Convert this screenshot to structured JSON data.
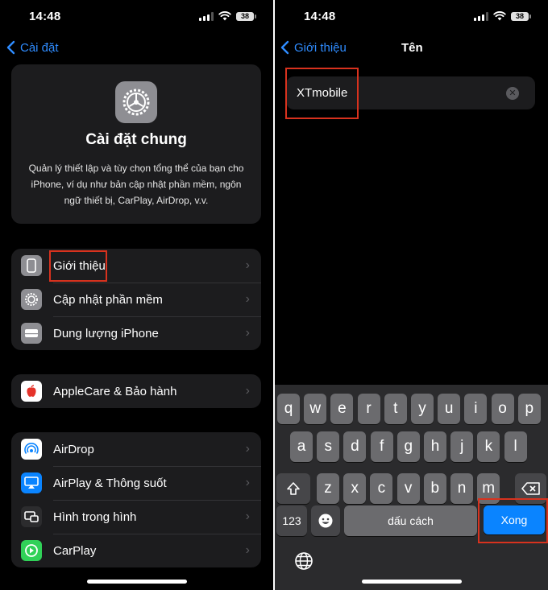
{
  "status": {
    "time": "14:48",
    "battery": "38"
  },
  "left": {
    "back_label": "Cài đặt",
    "card": {
      "title": "Cài đặt chung",
      "description": "Quản lý thiết lập và tùy chọn tổng thể của bạn cho iPhone, ví dụ như bản cập nhật phần mềm, ngôn ngữ thiết bị, CarPlay, AirDrop, v.v."
    },
    "group1": [
      {
        "label": "Giới thiệu",
        "icon": "iphone-icon",
        "color": "#8e8e93"
      },
      {
        "label": "Cập nhật phần mềm",
        "icon": "gear-icon",
        "color": "#8e8e93"
      },
      {
        "label": "Dung lượng iPhone",
        "icon": "storage-icon",
        "color": "#8e8e93"
      }
    ],
    "group2": [
      {
        "label": "AppleCare & Bảo hành",
        "icon": "apple-icon",
        "color": "#ffffff"
      }
    ],
    "group3": [
      {
        "label": "AirDrop",
        "icon": "airdrop-icon",
        "color": "#ffffff"
      },
      {
        "label": "AirPlay & Thông suốt",
        "icon": "airplay-icon",
        "color": "#0a84ff"
      },
      {
        "label": "Hình trong hình",
        "icon": "pip-icon",
        "color": "#2c2c2e"
      },
      {
        "label": "CarPlay",
        "icon": "carplay-icon",
        "color": "#30d158"
      }
    ]
  },
  "right": {
    "back_label": "Giới thiệu",
    "title": "Tên",
    "name_value": "XTmobile",
    "keyboard": {
      "row1": [
        "q",
        "w",
        "e",
        "r",
        "t",
        "y",
        "u",
        "i",
        "o",
        "p"
      ],
      "row2": [
        "a",
        "s",
        "d",
        "f",
        "g",
        "h",
        "j",
        "k",
        "l"
      ],
      "row3": [
        "z",
        "x",
        "c",
        "v",
        "b",
        "n",
        "m"
      ],
      "numbers_key": "123",
      "space_key": "dấu cách",
      "done_key": "Xong"
    }
  },
  "colors": {
    "accent": "#0a84ff",
    "link": "#2f8cff",
    "highlight": "#d8321e"
  }
}
